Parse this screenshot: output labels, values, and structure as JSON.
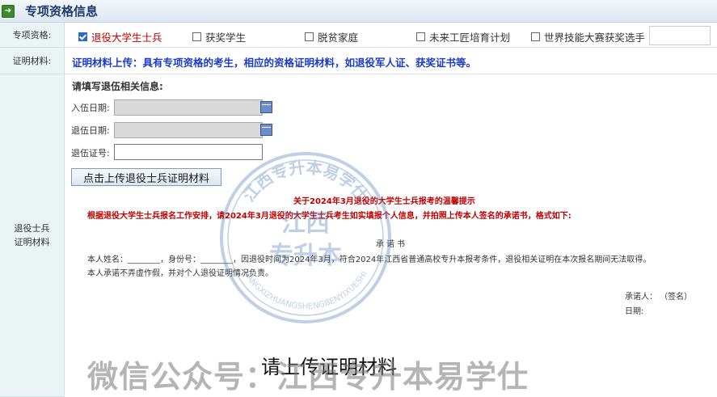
{
  "header": {
    "title": "专项资格信息",
    "icon": "arrow-right-icon"
  },
  "qualification": {
    "label": "专项资格:",
    "options": [
      {
        "label": "退役大学生士兵",
        "checked": true
      },
      {
        "label": "获奖学生",
        "checked": false
      },
      {
        "label": "脱贫家庭",
        "checked": false
      },
      {
        "label": "未来工匠培育计划",
        "checked": false
      },
      {
        "label": "世界技能大赛获奖选手",
        "checked": false
      }
    ]
  },
  "materials": {
    "label": "证明材料:",
    "note": "证明材料上传：具有专项资格的考生，相应的资格证明材料，如退役军人证、获奖证书等。"
  },
  "veteran": {
    "label_line1": "退役士兵",
    "label_line2": "证明材料",
    "section_title": "请填写退伍相关信息:",
    "enlist_label": "入伍日期:",
    "enlist_value": "",
    "discharge_label": "退伍日期:",
    "discharge_value": "",
    "cert_label": "退伍证号:",
    "cert_value": "",
    "upload_button": "点击上传退役士兵证明材料"
  },
  "notice": {
    "title": "关于2024年3月退役的大学生士兵报考的温馨提示",
    "body": "根据退役大学生士兵报名工作安排，请2024年3月退役的大学生士兵考生如实填报个人信息，并拍照上传本人签名的承诺书，格式如下:"
  },
  "pledge": {
    "title": "承诺书",
    "line1": "本人姓名：________，身份号：________，因退役时间为2024年3月，符合2024年江西省普通高校专升本报考条件，退役相关证明在本次报名期间无法取得。",
    "line2": "本人承诺不弄虚作假，并对个人退役证明情况负责。",
    "signer": "承诺人： （签名）",
    "date": "日期:"
  },
  "upload_prompt": "请上传证明材料",
  "watermark": {
    "text": "微信公众号：江西专升本易学仕",
    "stamp_top": "江西专升本易学仕",
    "stamp_center1": "江西",
    "stamp_center2": "专升本",
    "stamp_bottom": "JIANGXIZHUANGSHENGBENYIXUESHI"
  },
  "colors": {
    "accent_red": "#c00000",
    "accent_blue": "#1a3bc9",
    "label_bg": "#eaf4f4"
  }
}
